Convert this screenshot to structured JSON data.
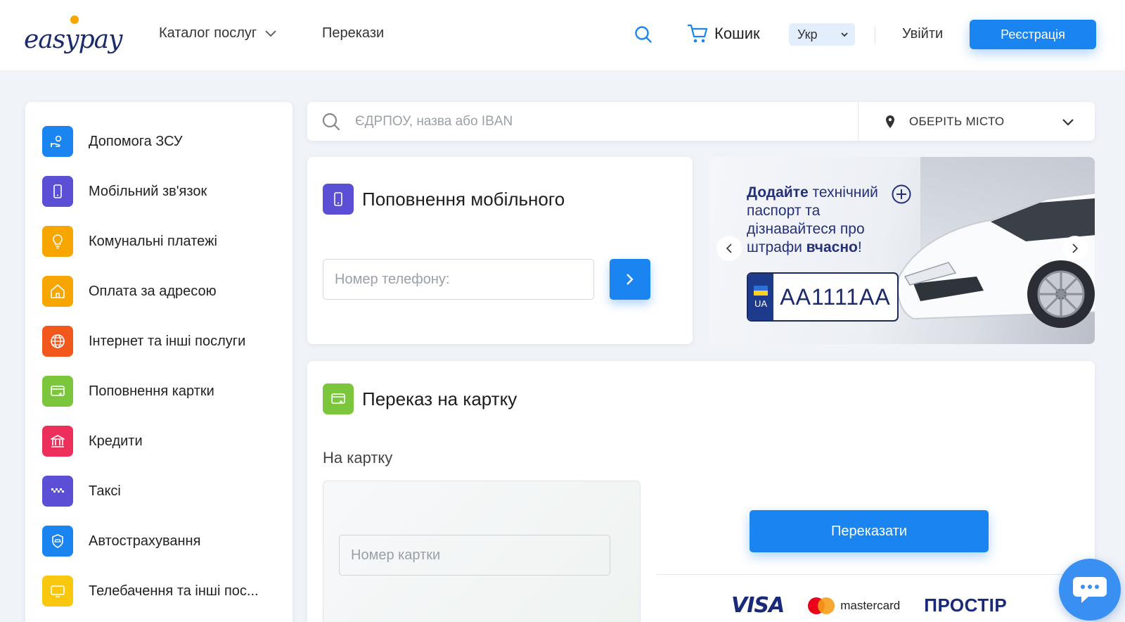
{
  "header": {
    "logo_left": "easy",
    "logo_right": "pay",
    "catalog_label": "Каталог послуг",
    "transfers_label": "Перекази",
    "cart_label": "Кошик",
    "language": "Укр",
    "login_label": "Увійти",
    "register_label": "Реєстрація"
  },
  "sidebar": {
    "items": [
      {
        "label": "Допомога ЗСУ",
        "color": "#1a85f0",
        "icon": "hand-heart-icon"
      },
      {
        "label": "Мобільний зв'язок",
        "color": "#5b4fd6",
        "icon": "phone-icon"
      },
      {
        "label": "Комунальні платежі",
        "color": "#f7a600",
        "icon": "bulb-icon"
      },
      {
        "label": "Оплата за адресою",
        "color": "#f7a600",
        "icon": "home-icon"
      },
      {
        "label": "Інтернет та інші послуги",
        "color": "#f2581c",
        "icon": "globe-icon"
      },
      {
        "label": "Поповнення картки",
        "color": "#7cc63c",
        "icon": "card-plus-icon"
      },
      {
        "label": "Кредити",
        "color": "#ec2f5b",
        "icon": "bank-icon"
      },
      {
        "label": "Таксі",
        "color": "#5b4fd6",
        "icon": "taxi-icon"
      },
      {
        "label": "Автострахування",
        "color": "#1a85f0",
        "icon": "car-shield-icon"
      },
      {
        "label": "Телебачення та інші пос...",
        "color": "#f9c80e",
        "icon": "tv-icon"
      }
    ]
  },
  "search": {
    "placeholder": "ЄДРПОУ, назва або IBAN",
    "city_label": "ОБЕРІТЬ МІСТО"
  },
  "mobile": {
    "title": "Поповнення мобільного",
    "phone_placeholder": "Номер телефону:"
  },
  "banner": {
    "line_bold_1": "Додайте",
    "line_1_rest": " технічний",
    "line_2": "паспорт та",
    "line_3": "дізнавайтеся про",
    "line_4_start": "штрафи ",
    "line_4_bold": "вчасно",
    "line_4_end": "!",
    "plate_country": "UA",
    "plate_number": "AA1111AA"
  },
  "transfer": {
    "title": "Переказ на картку",
    "subtitle": "На картку",
    "card_placeholder": "Номер картки",
    "send_label": "Переказати",
    "logos": {
      "visa": "VISA",
      "mastercard": "mastercard",
      "prostir": "ПРОСТІР"
    }
  },
  "colors": {
    "accent": "#1a85f0",
    "background": "#f0f3f8"
  }
}
